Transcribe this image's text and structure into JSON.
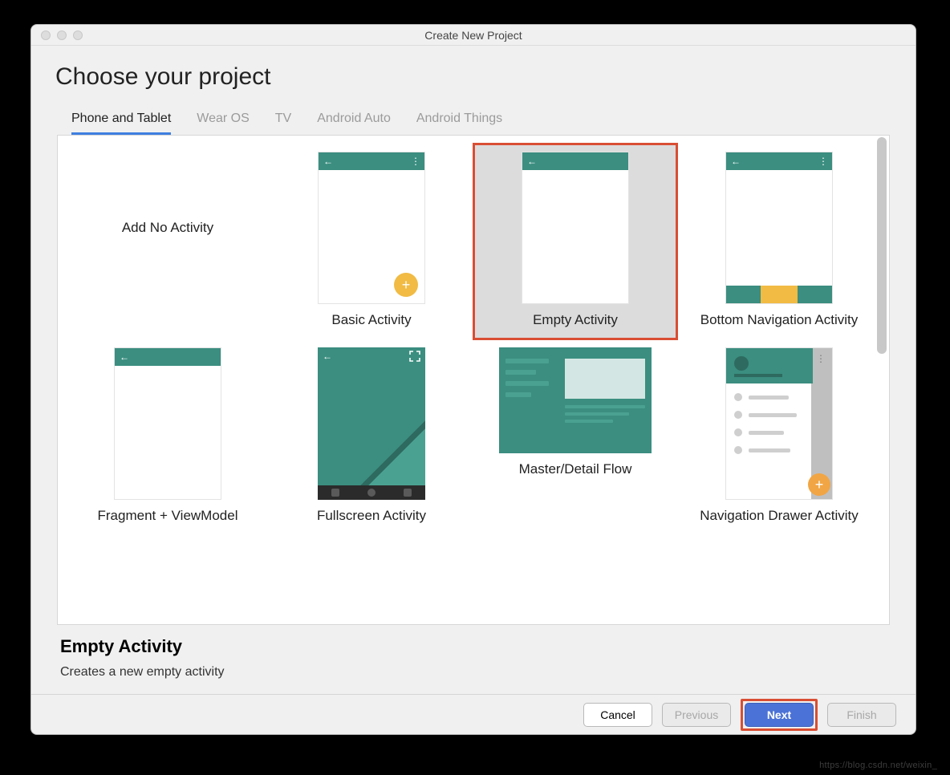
{
  "window": {
    "title": "Create New Project"
  },
  "header": {
    "title": "Choose your project"
  },
  "tabs": [
    {
      "label": "Phone and Tablet",
      "active": true
    },
    {
      "label": "Wear OS",
      "active": false
    },
    {
      "label": "TV",
      "active": false
    },
    {
      "label": "Android Auto",
      "active": false
    },
    {
      "label": "Android Things",
      "active": false
    }
  ],
  "templates": [
    {
      "label": "Add No Activity"
    },
    {
      "label": "Basic Activity"
    },
    {
      "label": "Empty Activity",
      "selected": true
    },
    {
      "label": "Bottom Navigation Activity"
    },
    {
      "label": "Fragment + ViewModel"
    },
    {
      "label": "Fullscreen Activity"
    },
    {
      "label": "Master/Detail Flow"
    },
    {
      "label": "Navigation Drawer Activity"
    }
  ],
  "description": {
    "title": "Empty Activity",
    "text": "Creates a new empty activity"
  },
  "buttons": {
    "cancel": "Cancel",
    "previous": "Previous",
    "next": "Next",
    "finish": "Finish"
  },
  "watermark": "https://blog.csdn.net/weixin_"
}
